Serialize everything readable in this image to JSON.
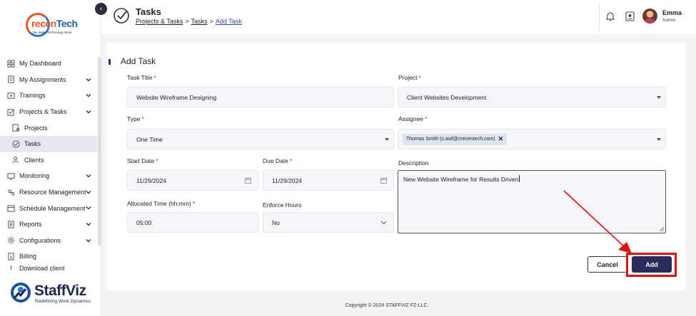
{
  "brand": {
    "logo_text_a": "recen",
    "logo_text_b": "Tech",
    "logo_tagline": "We Make Technology Work",
    "product_name": "StaffViz",
    "product_tagline": "Redefining Work Dynamics"
  },
  "sidebar": {
    "items": [
      {
        "label": "My Dashboard",
        "icon": "dashboard-icon",
        "expandable": false
      },
      {
        "label": "My Assignments",
        "icon": "assignments-icon",
        "expandable": true
      },
      {
        "label": "Trainings",
        "icon": "trainings-icon",
        "expandable": true
      },
      {
        "label": "Projects & Tasks",
        "icon": "projects-tasks-icon",
        "expandable": true
      },
      {
        "label": "Projects",
        "icon": "projects-icon",
        "sub": true
      },
      {
        "label": "Tasks",
        "icon": "tasks-icon",
        "sub": true,
        "active": true
      },
      {
        "label": "Clients",
        "icon": "clients-icon",
        "sub": true
      },
      {
        "label": "Monitoring",
        "icon": "monitoring-icon",
        "expandable": true
      },
      {
        "label": "Resource Management",
        "icon": "resource-icon",
        "expandable": true
      },
      {
        "label": "Schedule Management",
        "icon": "schedule-icon",
        "expandable": true
      },
      {
        "label": "Reports",
        "icon": "reports-icon",
        "expandable": true
      },
      {
        "label": "Configurations",
        "icon": "config-icon",
        "expandable": true
      },
      {
        "label": "Billing",
        "icon": "billing-icon",
        "expandable": false
      },
      {
        "label": "Download client",
        "icon": "download-icon",
        "expandable": false
      }
    ]
  },
  "header": {
    "title": "Tasks",
    "breadcrumb": [
      "Projects & Tasks",
      "Tasks",
      "Add Task"
    ],
    "separator": ">",
    "user_name": "Emma",
    "user_role": "Admin"
  },
  "form": {
    "title": "Add Task",
    "task_title_label": "Task Title",
    "task_title_value": "Website Wireframe Designing",
    "project_label": "Project",
    "project_value": "Client Websites Development",
    "type_label": "Type",
    "type_value": "One Time",
    "assignee_label": "Assignee",
    "assignee_tag": "Thomas Smith (s.asif@crecentech.com)",
    "start_date_label": "Start Date",
    "start_date_value": "11/29/2024",
    "due_date_label": "Due Date",
    "due_date_value": "11/29/2024",
    "description_label": "Description",
    "description_value": "New Website Wireframe for Results Driven",
    "allocated_label": "Allocated Time (hh:mm)",
    "allocated_value": "05:00",
    "enforce_label": "Enforce Hours",
    "enforce_value": "No",
    "required_mark": "*",
    "cancel_label": "Cancel",
    "add_label": "Add"
  },
  "footer": {
    "copyright": "Copyright © 2024 STAFFVIZ FZ-LLC."
  },
  "colors": {
    "primary": "#2a2d5c",
    "active_nav": "#e6e6f3",
    "required": "#e02020",
    "annotation": "#e01010"
  }
}
